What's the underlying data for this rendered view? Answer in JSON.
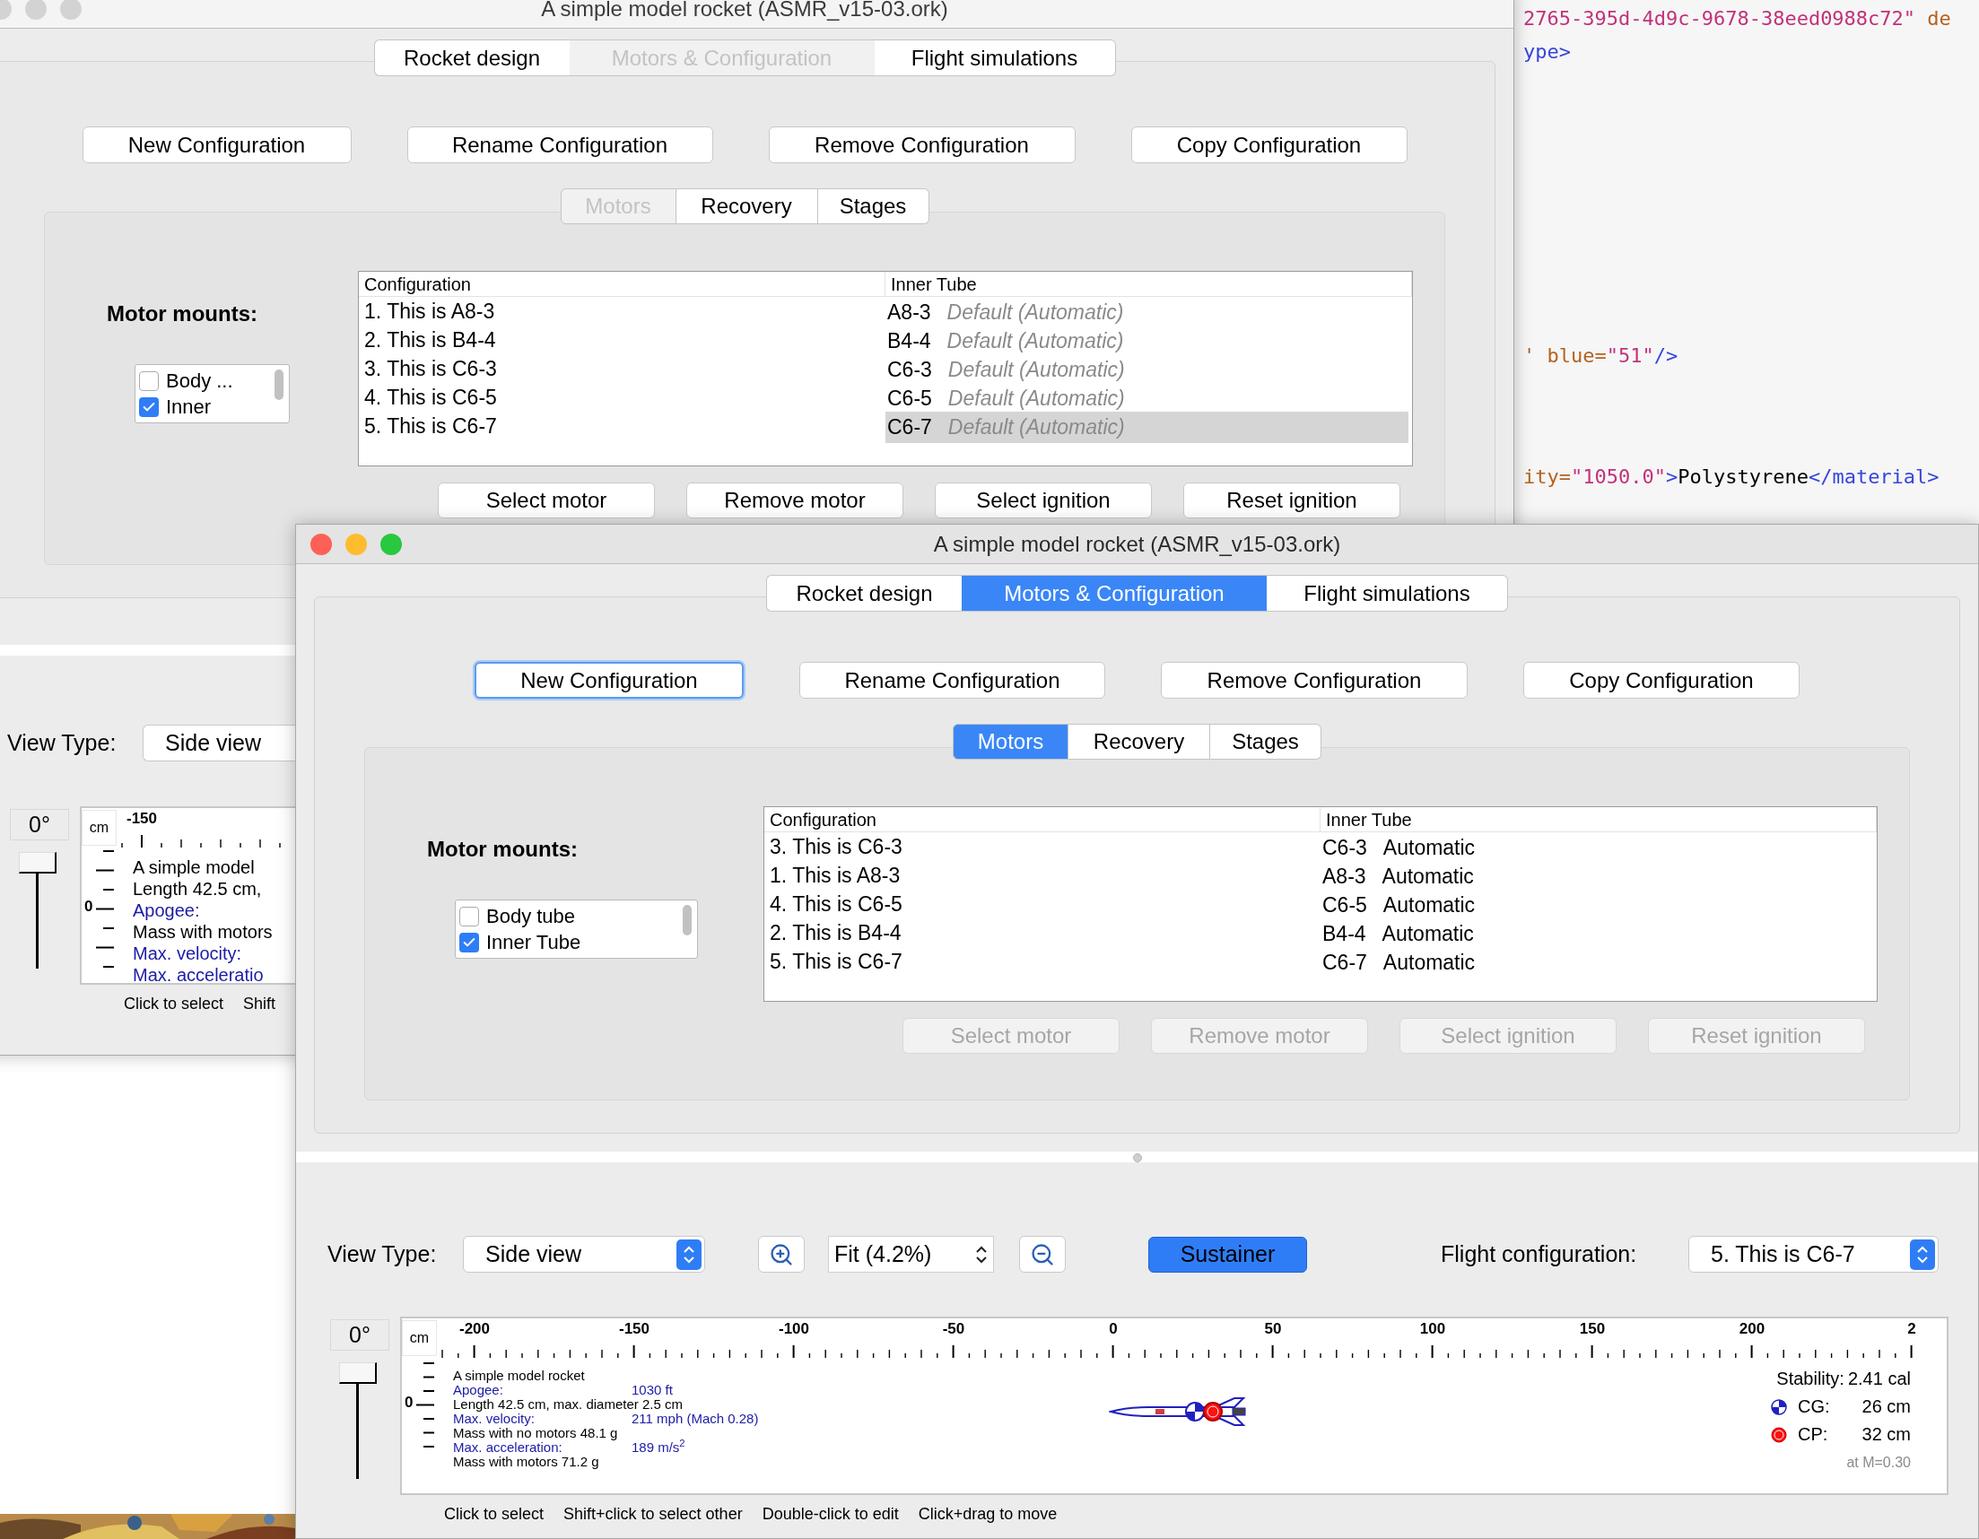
{
  "code_editor": {
    "lines": [
      [
        {
          "kind": "value",
          "text": "2765-395d-4d9c-9678-38eed0988c72\""
        },
        {
          "kind": "attr",
          "text": " de"
        }
      ],
      [
        {
          "kind": "tag",
          "text": "ype>"
        }
      ],
      [
        {
          "kind": "attr",
          "text": "' blue="
        },
        {
          "kind": "value",
          "text": "\"51\""
        },
        {
          "kind": "tag",
          "text": "/>"
        }
      ],
      [
        {
          "kind": "attr",
          "text": "ity="
        },
        {
          "kind": "value",
          "text": "\"1050.0\""
        },
        {
          "kind": "tag",
          "text": ">"
        },
        {
          "kind": "text",
          "text": "Polystyrene"
        },
        {
          "kind": "tag",
          "text": "</material>"
        }
      ]
    ]
  },
  "windows": [
    {
      "title": "A simple model rocket (ASMR_v15-03.ork)",
      "active": false,
      "tabs": [
        {
          "label": "Rocket design",
          "selected": false
        },
        {
          "label": "Motors & Configuration",
          "selected": true
        },
        {
          "label": "Flight simulations",
          "selected": false
        }
      ],
      "config_buttons": [
        {
          "label": "New Configuration",
          "focused": false
        },
        {
          "label": "Rename Configuration",
          "focused": false
        },
        {
          "label": "Remove Configuration",
          "focused": false
        },
        {
          "label": "Copy Configuration",
          "focused": false
        }
      ],
      "subtabs": [
        {
          "label": "Motors",
          "selected": true
        },
        {
          "label": "Recovery",
          "selected": false
        },
        {
          "label": "Stages",
          "selected": false
        }
      ],
      "motor_mounts_label": "Motor mounts:",
      "mounts": [
        {
          "label": "Body ...",
          "checked": false
        },
        {
          "label": "Inner",
          "checked": true
        }
      ],
      "table": {
        "columns": [
          "Configuration",
          "Inner Tube"
        ],
        "rows": [
          {
            "configuration": "1. This is A8-3",
            "motor": "A8-3",
            "ignition": "Default (Automatic)",
            "kind": "default",
            "selected": false
          },
          {
            "configuration": "2. This is B4-4",
            "motor": "B4-4",
            "ignition": "Default (Automatic)",
            "kind": "default",
            "selected": false
          },
          {
            "configuration": "3. This is C6-3",
            "motor": "C6-3",
            "ignition": "Default (Automatic)",
            "kind": "default",
            "selected": false
          },
          {
            "configuration": "4. This is C6-5",
            "motor": "C6-5",
            "ignition": "Default (Automatic)",
            "kind": "default",
            "selected": false
          },
          {
            "configuration": "5. This is C6-7",
            "motor": "C6-7",
            "ignition": "Default (Automatic)",
            "kind": "default",
            "selected": true
          }
        ]
      },
      "motor_buttons": [
        {
          "label": "Select motor",
          "disabled": false
        },
        {
          "label": "Remove motor",
          "disabled": false
        },
        {
          "label": "Select ignition",
          "disabled": false
        },
        {
          "label": "Reset ignition",
          "disabled": false
        }
      ],
      "view_type_label": "View Type:",
      "view_type": "Side view",
      "angle": "0°",
      "rotation": {
        "level": 1
      },
      "ruler": {
        "unit": "cm",
        "labels": [
          "-150"
        ],
        "zero_label": "0"
      },
      "info_lines": [
        {
          "kind": "plain",
          "text": "A simple model"
        },
        {
          "kind": "plain",
          "text": "Length 42.5 cm,"
        },
        {
          "kind": "stat",
          "label": "Apogee:"
        },
        {
          "kind": "plain",
          "text": "Mass with motors"
        },
        {
          "kind": "stat",
          "label": "Max. velocity:"
        },
        {
          "kind": "stat",
          "label": "Max. acceleratio"
        }
      ],
      "hints": [
        "Click to select",
        "Shift"
      ]
    },
    {
      "title": "A simple model rocket (ASMR_v15-03.ork)",
      "active": true,
      "tabs": [
        {
          "label": "Rocket design",
          "selected": false
        },
        {
          "label": "Motors & Configuration",
          "selected": true
        },
        {
          "label": "Flight simulations",
          "selected": false
        }
      ],
      "config_buttons": [
        {
          "label": "New Configuration",
          "focused": true
        },
        {
          "label": "Rename Configuration",
          "focused": false
        },
        {
          "label": "Remove Configuration",
          "focused": false
        },
        {
          "label": "Copy Configuration",
          "focused": false
        }
      ],
      "subtabs": [
        {
          "label": "Motors",
          "selected": true
        },
        {
          "label": "Recovery",
          "selected": false
        },
        {
          "label": "Stages",
          "selected": false
        }
      ],
      "motor_mounts_label": "Motor mounts:",
      "mounts": [
        {
          "label": "Body tube",
          "checked": false
        },
        {
          "label": "Inner Tube",
          "checked": true
        }
      ],
      "table": {
        "columns": [
          "Configuration",
          "Inner Tube"
        ],
        "rows": [
          {
            "configuration": "3. This is C6-3",
            "motor": "C6-3",
            "ignition": "Automatic",
            "kind": "explicit",
            "selected": false
          },
          {
            "configuration": "1. This is A8-3",
            "motor": "A8-3",
            "ignition": "Automatic",
            "kind": "explicit",
            "selected": false
          },
          {
            "configuration": "4. This is C6-5",
            "motor": "C6-5",
            "ignition": "Automatic",
            "kind": "explicit",
            "selected": false
          },
          {
            "configuration": "2. This is B4-4",
            "motor": "B4-4",
            "ignition": "Automatic",
            "kind": "explicit",
            "selected": false
          },
          {
            "configuration": "5. This is C6-7",
            "motor": "C6-7",
            "ignition": "Automatic",
            "kind": "explicit",
            "selected": false
          }
        ]
      },
      "motor_buttons": [
        {
          "label": "Select motor",
          "disabled": true
        },
        {
          "label": "Remove motor",
          "disabled": true
        },
        {
          "label": "Select ignition",
          "disabled": true
        },
        {
          "label": "Reset ignition",
          "disabled": true
        }
      ],
      "view_type_label": "View Type:",
      "view_type": "Side view",
      "fit": "Fit (4.2%)",
      "stages": [
        {
          "label": "Sustainer",
          "selected": true
        }
      ],
      "flight_config_label": "Flight configuration:",
      "flight_config": "5. This is C6-7",
      "angle": "0°",
      "rotation": {
        "level": 1
      },
      "ruler": {
        "unit": "cm",
        "labels": [
          "-200",
          "-150",
          "-100",
          "-50",
          "0",
          "50",
          "100",
          "150",
          "200",
          "2"
        ],
        "zero_label": "0"
      },
      "info_lines": [
        {
          "kind": "plain",
          "text": "A simple model rocket"
        },
        {
          "kind": "stat",
          "label": "Apogee:",
          "value": "1030 ft"
        },
        {
          "kind": "plain",
          "text": "Length 42.5 cm, max. diameter 2.5 cm"
        },
        {
          "kind": "stat",
          "label": "Max. velocity:",
          "value": "211 mph  (Mach 0.28)"
        },
        {
          "kind": "plain",
          "text": "Mass with no motors 48.1 g"
        },
        {
          "kind": "stat",
          "label": "Max. acceleration:",
          "value": "189 m/s$^{2}$"
        },
        {
          "kind": "plain",
          "text": "Mass with motors 71.2 g"
        }
      ],
      "stability": {
        "label": "Stability:",
        "value": "2.41 cal",
        "cg_label": "CG:",
        "cg_value": "26 cm",
        "cp_label": "CP:",
        "cp_value": "32 cm",
        "note": "at M=0.30"
      },
      "hints": [
        "Click to select",
        "Shift+click to select other",
        "Double-click to edit",
        "Click+drag to move"
      ]
    }
  ]
}
